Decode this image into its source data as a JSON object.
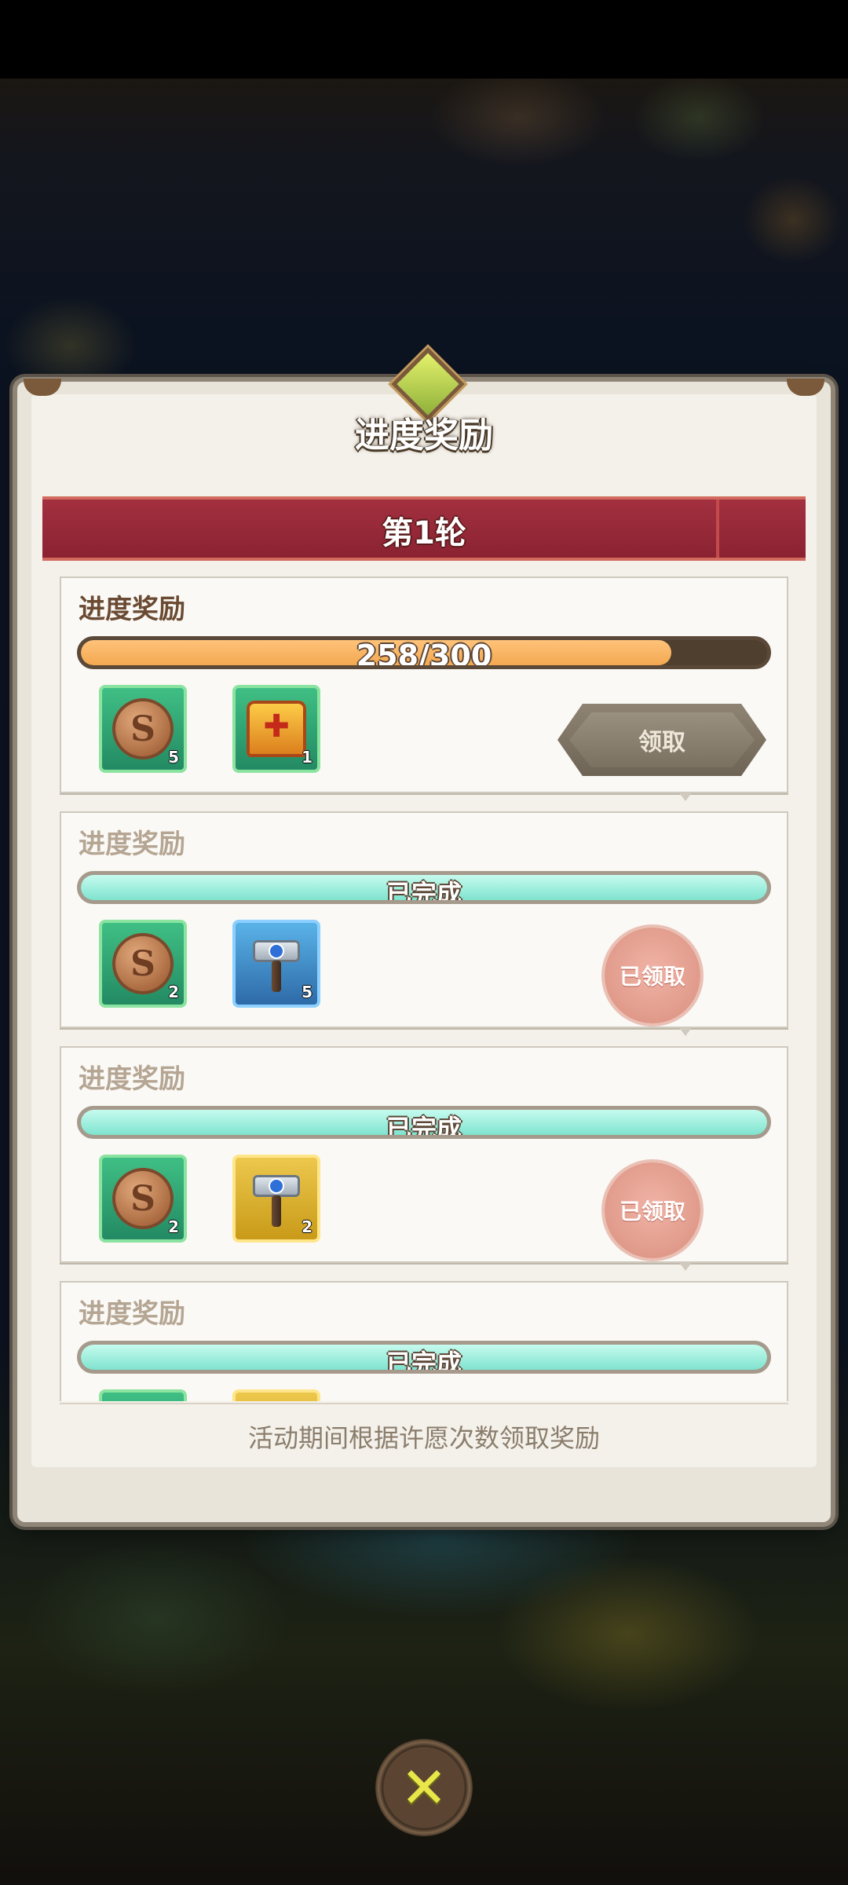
{
  "dialog": {
    "title": "进度奖励",
    "round_title": "第1轮",
    "footer_hint": "活动期间根据许愿次数领取奖励"
  },
  "reward_cards": [
    {
      "title": "进度奖励",
      "state": "active",
      "progress_text": "258/300",
      "progress_fraction": 0.86,
      "items": [
        {
          "icon": "dragon-coin-icon",
          "count": "5"
        },
        {
          "icon": "treasure-chest-icon",
          "count": "1"
        }
      ],
      "action_label": "领取"
    },
    {
      "title": "进度奖励",
      "state": "claimed",
      "progress_text": "已完成",
      "progress_fraction": 1.0,
      "items": [
        {
          "icon": "dragon-coin-icon",
          "count": "2"
        },
        {
          "icon": "blue-hammer-icon",
          "count": "5"
        }
      ],
      "action_label": "已领取"
    },
    {
      "title": "进度奖励",
      "state": "claimed",
      "progress_text": "已完成",
      "progress_fraction": 1.0,
      "items": [
        {
          "icon": "dragon-coin-icon",
          "count": "2"
        },
        {
          "icon": "gold-hammer-icon",
          "count": "2"
        }
      ],
      "action_label": "已领取"
    },
    {
      "title": "进度奖励",
      "state": "claimed",
      "progress_text": "已完成",
      "progress_fraction": 1.0,
      "items": [],
      "action_label": ""
    }
  ],
  "close_icon": "close-x-icon",
  "colors": {
    "round_band": "#8a2232",
    "active_progress": "#f3a850",
    "done_progress": "#7fe3cf",
    "stamp": "#e09a8a",
    "close_x": "#e9e64a"
  }
}
